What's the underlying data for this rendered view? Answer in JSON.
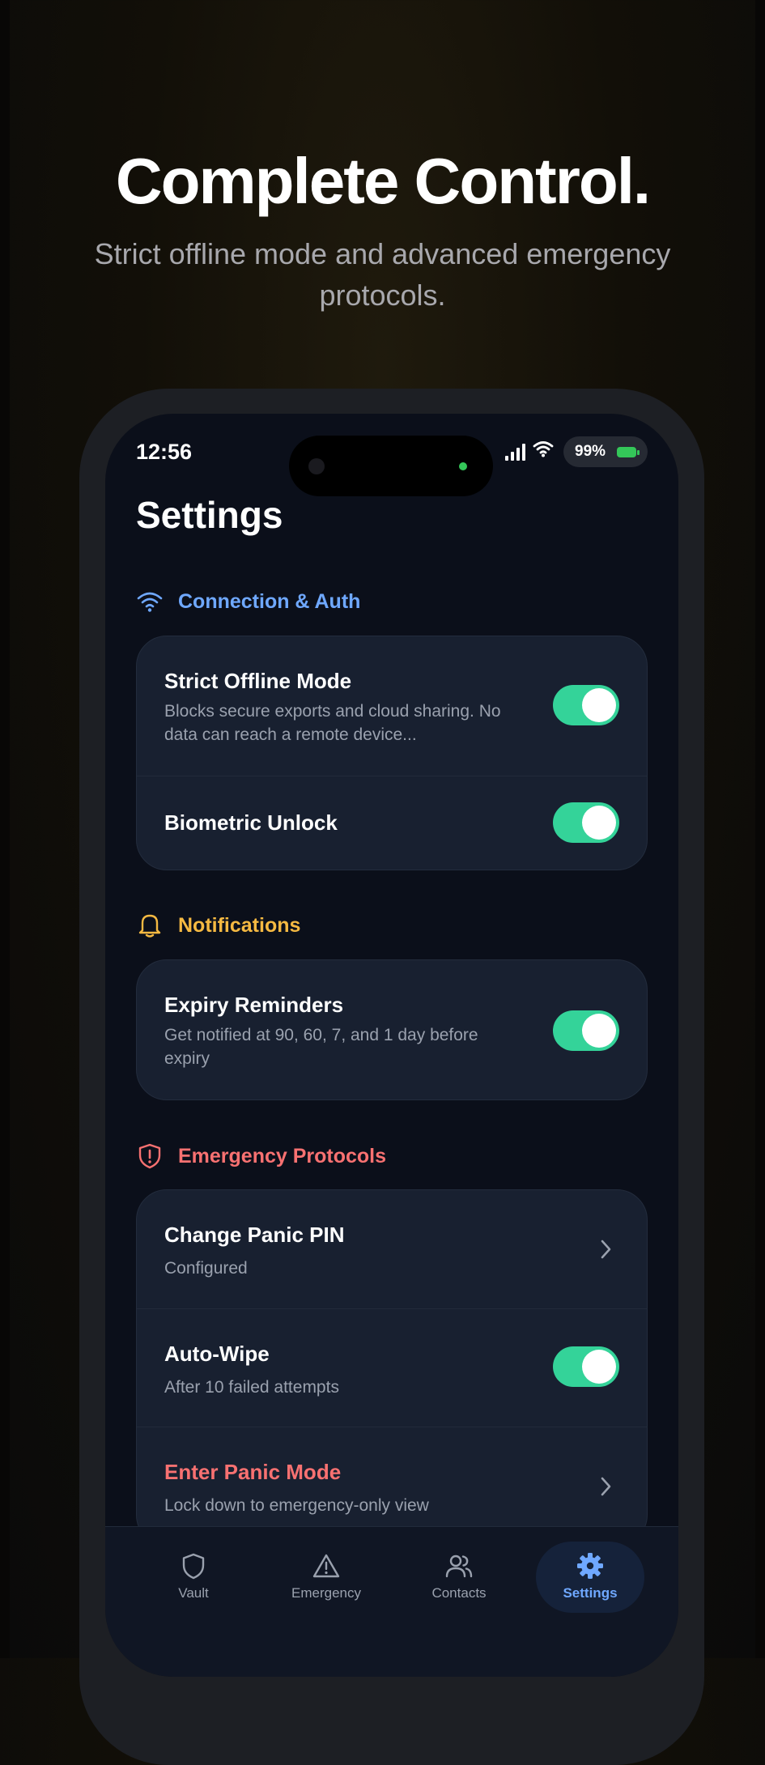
{
  "promo": {
    "headline": "Complete Control.",
    "subheadline": "Strict offline mode and advanced emergency protocols."
  },
  "status_bar": {
    "time": "12:56",
    "battery": "99%",
    "icons": [
      "signal-icon",
      "wifi-icon",
      "battery-icon"
    ]
  },
  "screen": {
    "title": "Settings"
  },
  "sections": {
    "connection": {
      "title": "Connection & Auth",
      "icon": "wifi-icon",
      "color": "#6fa8ff",
      "rows": [
        {
          "title": "Strict Offline Mode",
          "subtitle": "Blocks secure exports and cloud sharing. No data can reach a remote device...",
          "control": "toggle",
          "enabled": true
        },
        {
          "title": "Biometric Unlock",
          "control": "toggle",
          "enabled": true
        }
      ]
    },
    "notifications": {
      "title": "Notifications",
      "icon": "bell-icon",
      "color": "#f5b942",
      "rows": [
        {
          "title": "Expiry Reminders",
          "subtitle": "Get notified at 90, 60, 7, and 1 day before expiry",
          "control": "toggle",
          "enabled": true
        }
      ]
    },
    "emergency": {
      "title": "Emergency Protocols",
      "icon": "shield-alert-icon",
      "color": "#f87171",
      "rows": [
        {
          "title": "Change Panic PIN",
          "subtitle": "Configured",
          "control": "chevron"
        },
        {
          "title": "Auto-Wipe",
          "subtitle": "After 10 failed attempts",
          "control": "toggle",
          "enabled": true
        },
        {
          "title": "Enter Panic Mode",
          "subtitle": "Lock down to emergency-only view",
          "control": "chevron",
          "title_color": "#f87171"
        }
      ]
    }
  },
  "tab_bar": {
    "tabs": [
      {
        "label": "Vault",
        "icon": "shield-icon",
        "active": false
      },
      {
        "label": "Emergency",
        "icon": "warning-icon",
        "active": false
      },
      {
        "label": "Contacts",
        "icon": "contacts-icon",
        "active": false
      },
      {
        "label": "Settings",
        "icon": "gear-icon",
        "active": true
      }
    ],
    "active_color": "#6fa8ff"
  },
  "colors": {
    "toggle_on": "#34d399",
    "background": "#0b0f1a",
    "card": "#182030"
  }
}
